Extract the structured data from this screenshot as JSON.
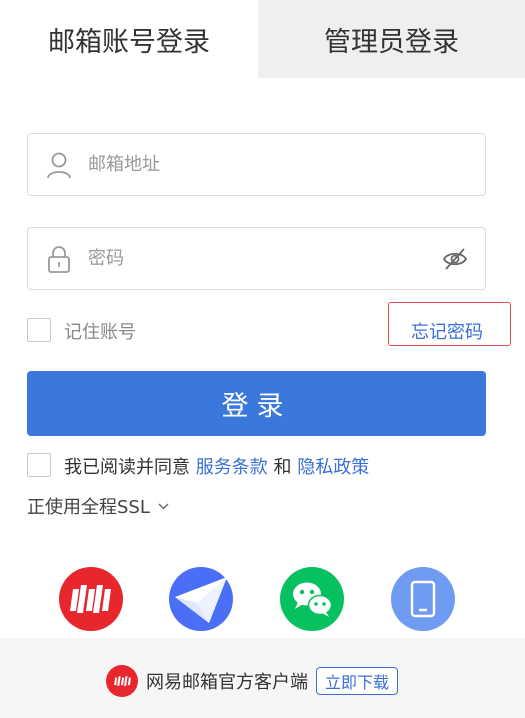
{
  "tabs": {
    "account_login": "邮箱账号登录",
    "admin_login": "管理员登录"
  },
  "email": {
    "placeholder": "邮箱地址",
    "value": "",
    "icon": "user-icon"
  },
  "password": {
    "placeholder": "密码",
    "value": "",
    "icon": "lock-icon",
    "toggle_icon": "eye-hidden-icon"
  },
  "remember": {
    "label": "记住账号",
    "checked": false
  },
  "forgot_password": "忘记密码",
  "login_button": "登录",
  "agreement": {
    "checked": false,
    "prefix": "我已阅读并同意",
    "terms": "服务条款",
    "and": "和",
    "privacy": "隐私政策"
  },
  "ssl": {
    "label": "正使用全程SSL"
  },
  "third_party": [
    {
      "name": "netease-open-icon",
      "color": "#e8262d"
    },
    {
      "name": "paper-plane-icon",
      "color": "#4a6ef5"
    },
    {
      "name": "wechat-icon",
      "color": "#07c160"
    },
    {
      "name": "mobile-phone-icon",
      "color": "#6f9bf2"
    }
  ],
  "footer": {
    "text": "网易邮箱官方客户端",
    "download": "立即下载"
  },
  "colors": {
    "accent": "#3b78dc",
    "link": "#3a6fd6",
    "highlight_border": "#e04a4a"
  }
}
